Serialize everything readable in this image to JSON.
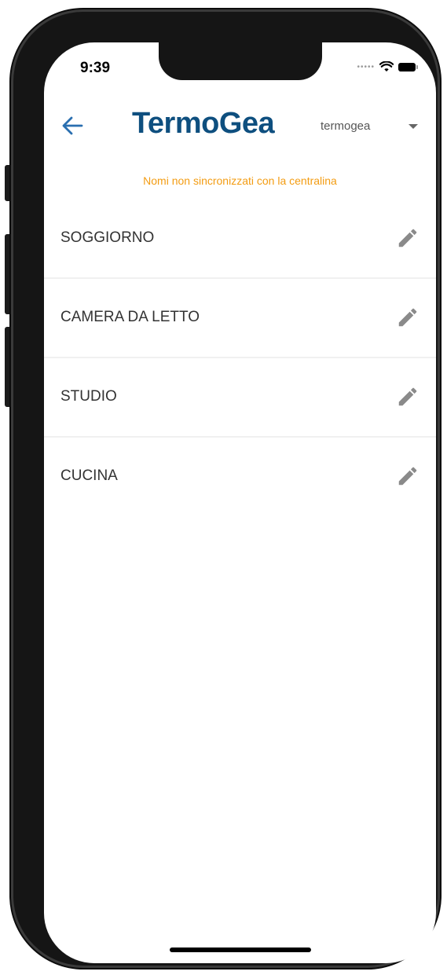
{
  "status_bar": {
    "time": "9:39",
    "signal_icon": "cellular-dots-icon",
    "wifi_icon": "wifi-icon",
    "battery_icon": "battery-icon"
  },
  "header": {
    "back_icon": "arrow-left-icon",
    "logo_text": "TermoGea",
    "account_selector": {
      "selected": "termogea",
      "icon": "caret-down-icon"
    }
  },
  "notice": {
    "text": "Nomi non sincronizzati con la centralina",
    "color": "#f39c12"
  },
  "rooms": [
    {
      "name": "SOGGIORNO",
      "action_icon": "pencil-icon"
    },
    {
      "name": "CAMERA DA LETTO",
      "action_icon": "pencil-icon"
    },
    {
      "name": "STUDIO",
      "action_icon": "pencil-icon"
    },
    {
      "name": "CUCINA",
      "action_icon": "pencil-icon"
    }
  ],
  "colors": {
    "brand": "#0e4f7f",
    "back_arrow": "#2a6fb0",
    "warning": "#f39c12",
    "row_divider": "#f0f0f0",
    "edit_icon": "#8a8a8a"
  }
}
